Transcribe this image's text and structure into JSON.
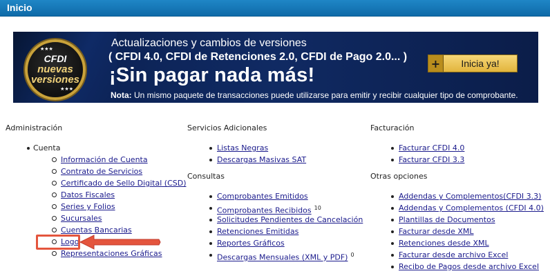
{
  "header": {
    "title": "Inicio"
  },
  "banner": {
    "badge": {
      "line1": "CFDI",
      "line2": "nuevas",
      "line3": "versiones"
    },
    "headline1": "Actualizaciones y cambios de versiones",
    "headline2": "( CFDI 4.0, CFDI de Retenciones 2.0, CFDI de Pago 2.0... )",
    "headline3": "¡Sin pagar nada más!",
    "note_label": "Nota:",
    "note_text": " Un mismo paquete de transacciones puede utilizarse para emitir y recibir cualquier tipo de comprobante.",
    "cta_plus": "+",
    "cta_label": "Inicia ya!"
  },
  "administracion": {
    "heading": "Administración",
    "cuenta_label": "Cuenta",
    "items": [
      "Información de Cuenta",
      "Contrato de Servicios",
      "Certificado de Sello Digital (CSD)",
      "Datos Fiscales",
      "Series y Folios",
      "Sucursales",
      "Cuentas Bancarias",
      "Logo",
      "Representaciones Gráficas"
    ]
  },
  "servicios": {
    "heading": "Servicios Adicionales",
    "items": [
      "Listas Negras",
      "Descargas Masivas SAT"
    ]
  },
  "consultas": {
    "heading": "Consultas",
    "items": [
      "Comprobantes Emitidos",
      "Comprobantes Recibidos",
      "Solicitudes Pendientes de Cancelación",
      "Retenciones Emitidas",
      "Reportes Gráficos",
      "Descargas Mensuales (XML y PDF)"
    ],
    "recibidos_count": "10",
    "descargas_count": "0"
  },
  "facturacion": {
    "heading": "Facturación",
    "items": [
      "Facturar CFDI 4.0",
      "Facturar CFDI 3.3"
    ]
  },
  "otras": {
    "heading": "Otras opciones",
    "items": [
      "Addendas y Complementos(CFDI 3.3)",
      "Addendas y Complementos (CFDI 4.0)",
      "Plantillas de Documentos",
      "Facturar desde XML",
      "Retenciones desde XML",
      "Facturar desde archivo Excel",
      "Recibo de Pagos desde archivo Excel"
    ]
  },
  "colors": {
    "header_blue": "#1478b8",
    "link": "#1a1a8c",
    "highlight": "#e4553d",
    "banner_navy": "#0e2660",
    "cta_gold": "#e9c04f"
  },
  "icons": {
    "annotation": "arrow-left-icon"
  }
}
